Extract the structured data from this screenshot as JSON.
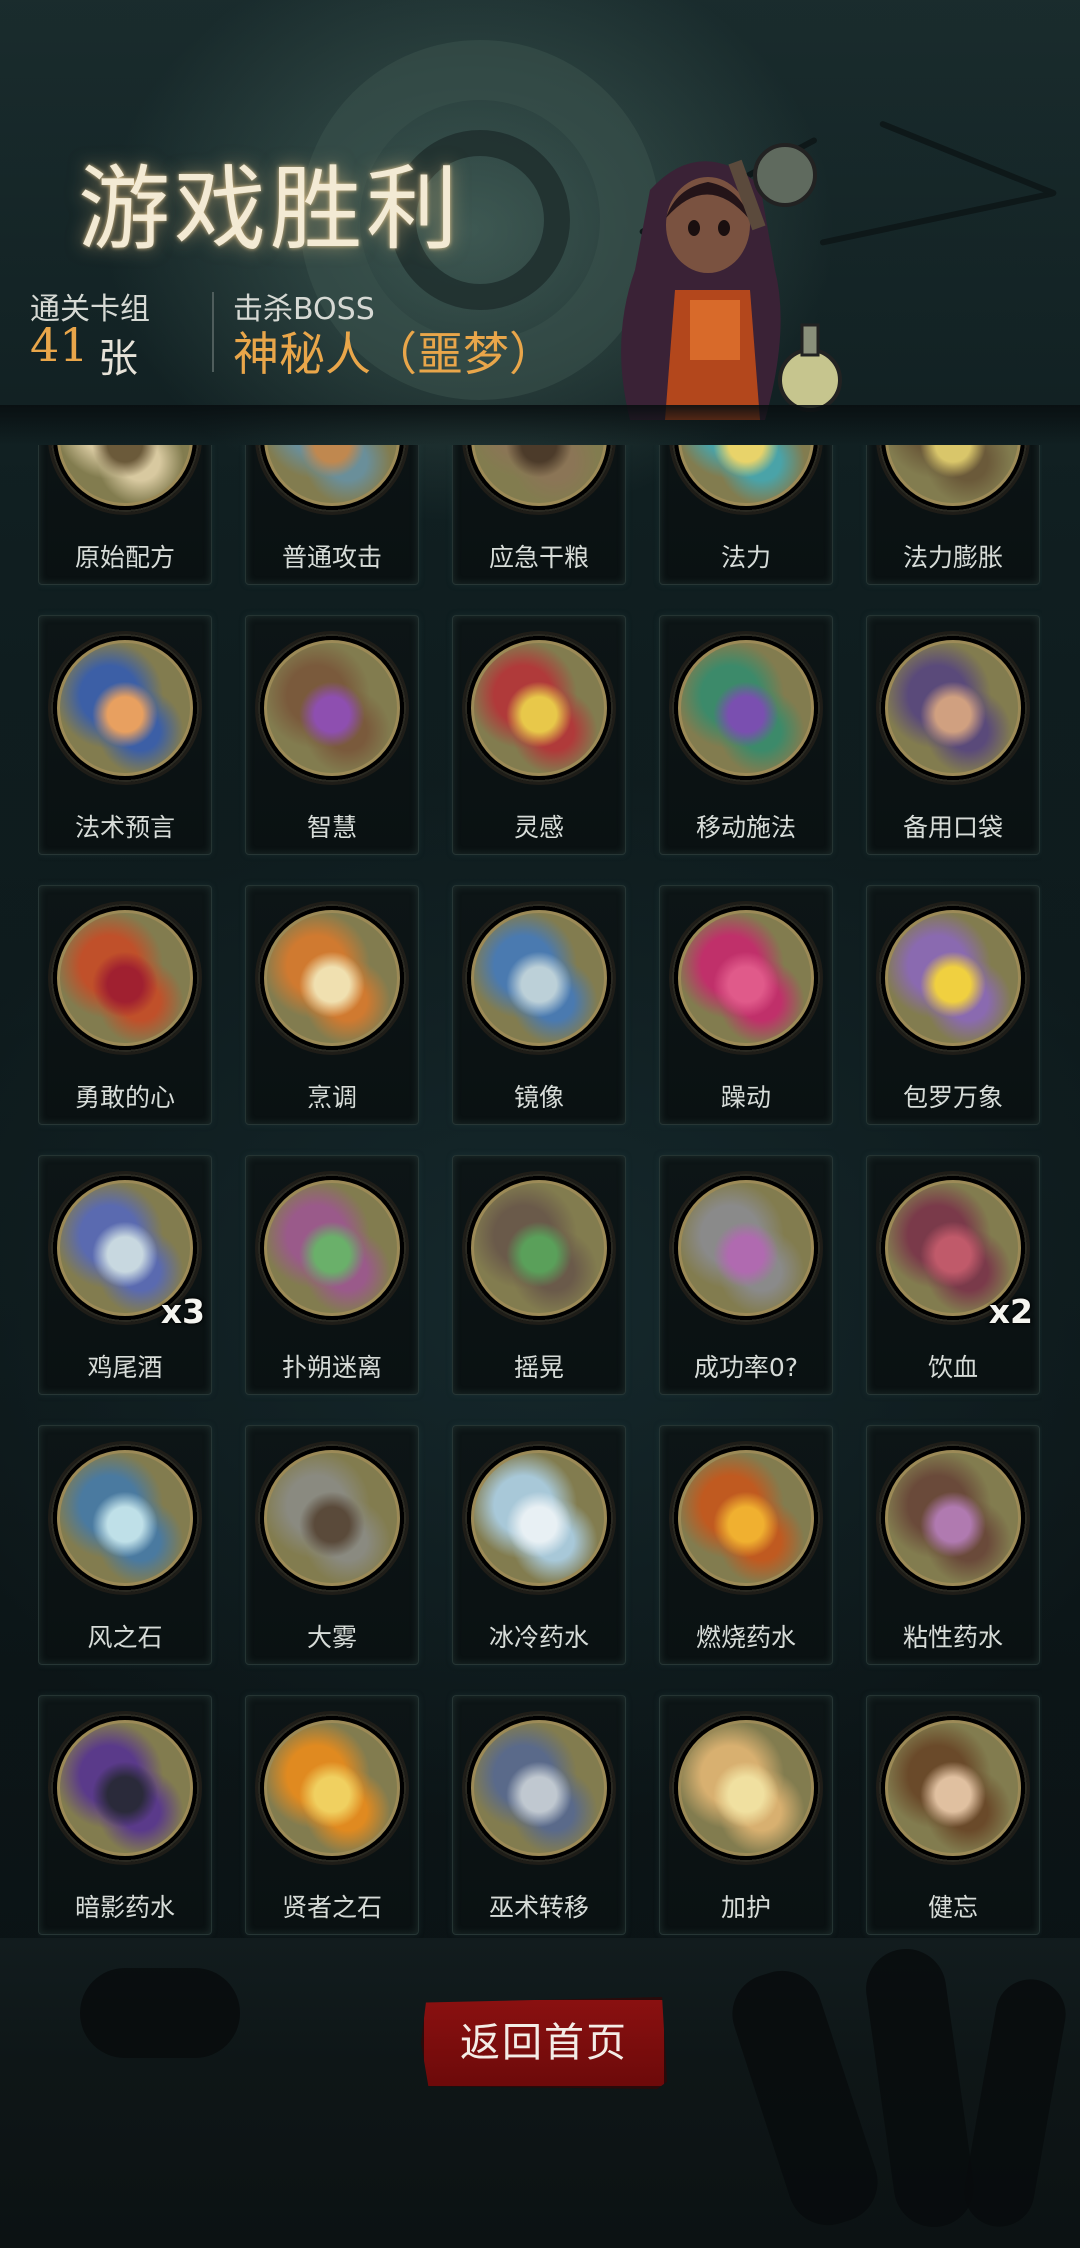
{
  "header": {
    "title": "游戏胜利",
    "cleared_label": "通关卡组",
    "cleared_count": "41",
    "cleared_unit": "张",
    "boss_label": "击杀BOSS",
    "boss_name": "神秘人（噩梦）"
  },
  "cards": [
    {
      "name": "原始配方",
      "icon": "recipe-scroll-icon"
    },
    {
      "name": "普通攻击",
      "icon": "potion-bottle-icon"
    },
    {
      "name": "应急干粮",
      "icon": "ration-box-icon"
    },
    {
      "name": "法力",
      "icon": "mana-orb-icon"
    },
    {
      "name": "法力膨胀",
      "icon": "hooded-mage-icon"
    },
    {
      "name": "法术预言",
      "icon": "crystal-ball-icon"
    },
    {
      "name": "智慧",
      "icon": "old-sage-icon"
    },
    {
      "name": "灵感",
      "icon": "brain-skull-icon"
    },
    {
      "name": "移动施法",
      "icon": "witch-hat-mage-icon"
    },
    {
      "name": "备用口袋",
      "icon": "pouch-hand-icon"
    },
    {
      "name": "勇敢的心",
      "icon": "brave-heart-icon"
    },
    {
      "name": "烹调",
      "icon": "fox-cook-icon"
    },
    {
      "name": "镜像",
      "icon": "mirror-orb-icon"
    },
    {
      "name": "躁动",
      "icon": "restless-face-icon"
    },
    {
      "name": "包罗万象",
      "icon": "treasure-cauldron-icon"
    },
    {
      "name": "鸡尾酒",
      "icon": "cocktail-vampire-icon",
      "multiplier": "x3"
    },
    {
      "name": "扑朔迷离",
      "icon": "mysterious-vortex-icon"
    },
    {
      "name": "摇晃",
      "icon": "shaking-potion-icon"
    },
    {
      "name": "成功率0?",
      "icon": "caged-creature-icon"
    },
    {
      "name": "饮血",
      "icon": "blood-drinker-icon",
      "multiplier": "x2"
    },
    {
      "name": "风之石",
      "icon": "wind-stone-icon"
    },
    {
      "name": "大雾",
      "icon": "fog-beast-icon"
    },
    {
      "name": "冰冷药水",
      "icon": "ice-potion-icon"
    },
    {
      "name": "燃烧药水",
      "icon": "fire-potion-icon"
    },
    {
      "name": "粘性药水",
      "icon": "sticky-potion-icon"
    },
    {
      "name": "暗影药水",
      "icon": "shadow-skeleton-icon"
    },
    {
      "name": "贤者之石",
      "icon": "philosopher-stone-icon"
    },
    {
      "name": "巫术转移",
      "icon": "wizard-transfer-icon"
    },
    {
      "name": "加护",
      "icon": "shield-bubble-icon"
    },
    {
      "name": "健忘",
      "icon": "forgetful-captain-icon"
    }
  ],
  "colors": {
    "accent_gold": "#e9a64a",
    "button_red": "#7d0e0e",
    "medal_olive": "#827c4f"
  },
  "footer": {
    "home_button_label": "返回首页"
  }
}
